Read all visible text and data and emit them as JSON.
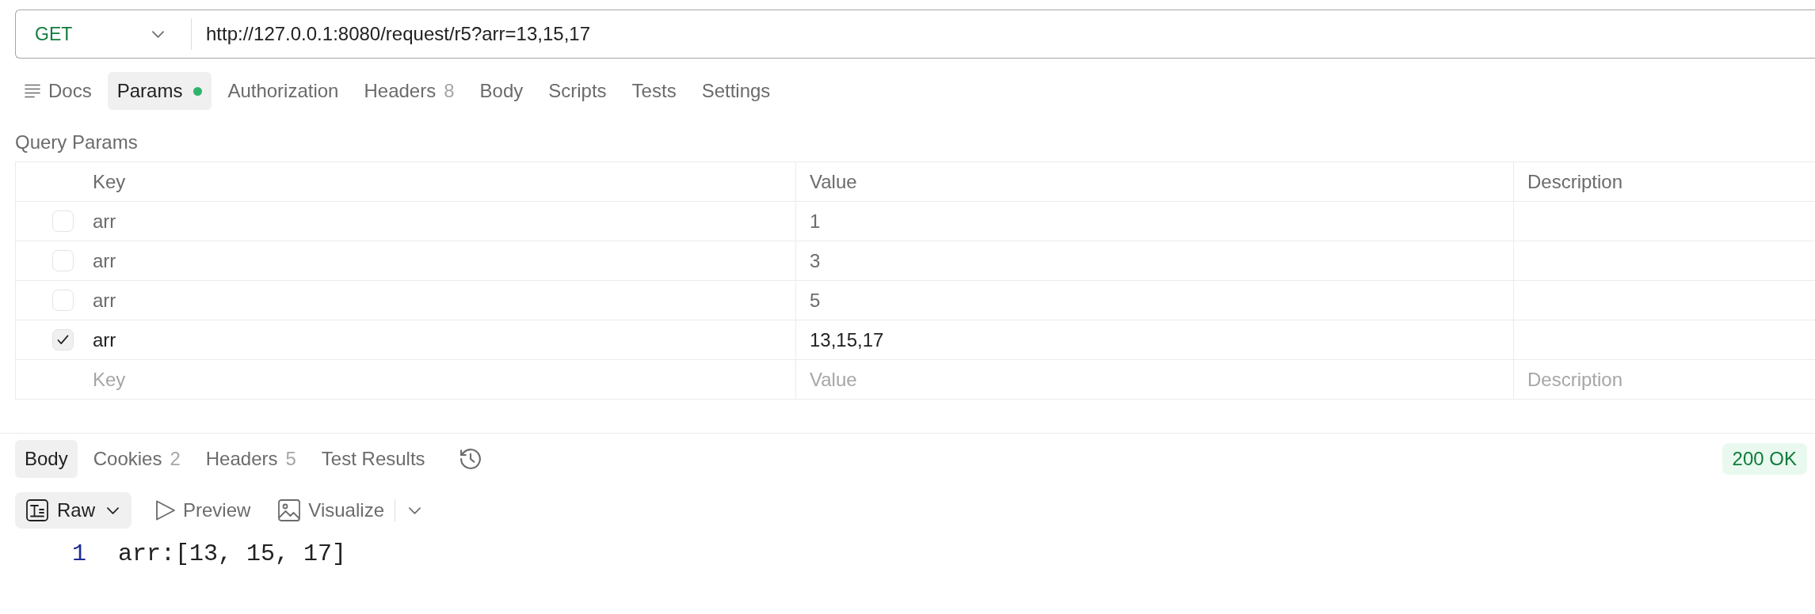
{
  "request": {
    "method": "GET",
    "url": "http://127.0.0.1:8080/request/r5?arr=13,15,17"
  },
  "request_tabs": [
    {
      "label": "Docs",
      "kind": "docs",
      "selected": false,
      "dot": false
    },
    {
      "label": "Params",
      "kind": "tab",
      "selected": true,
      "dot": true
    },
    {
      "label": "Authorization",
      "kind": "tab",
      "selected": false,
      "dot": false
    },
    {
      "label": "Headers",
      "kind": "tab",
      "count": "8",
      "selected": false,
      "dot": false
    },
    {
      "label": "Body",
      "kind": "tab",
      "selected": false,
      "dot": false
    },
    {
      "label": "Scripts",
      "kind": "tab",
      "selected": false,
      "dot": false
    },
    {
      "label": "Tests",
      "kind": "tab",
      "selected": false,
      "dot": false
    },
    {
      "label": "Settings",
      "kind": "tab",
      "selected": false,
      "dot": false
    }
  ],
  "query_params": {
    "title": "Query Params",
    "columns": [
      "Key",
      "Value",
      "Description"
    ],
    "rows": [
      {
        "checked": false,
        "key": "arr",
        "value": "1"
      },
      {
        "checked": false,
        "key": "arr",
        "value": "3"
      },
      {
        "checked": false,
        "key": "arr",
        "value": "5"
      },
      {
        "checked": true,
        "key": "arr",
        "value": "13,15,17"
      }
    ],
    "new_row": {
      "key": {
        "placeholder": "Key"
      },
      "value": {
        "placeholder": "Value"
      },
      "description": {
        "placeholder": "Description"
      }
    }
  },
  "response": {
    "tabs": [
      {
        "label": "Body",
        "selected": true
      },
      {
        "label": "Cookies",
        "count": "2",
        "selected": false
      },
      {
        "label": "Headers",
        "count": "5",
        "selected": false
      },
      {
        "label": "Test Results",
        "selected": false
      }
    ],
    "status": "200 OK",
    "format": "Raw",
    "views": [
      {
        "label": "Preview",
        "kind": "preview"
      },
      {
        "label": "Visualize",
        "kind": "visualize"
      }
    ],
    "lines": [
      {
        "number": "1",
        "text": "arr:[13, 15, 17]"
      }
    ]
  }
}
